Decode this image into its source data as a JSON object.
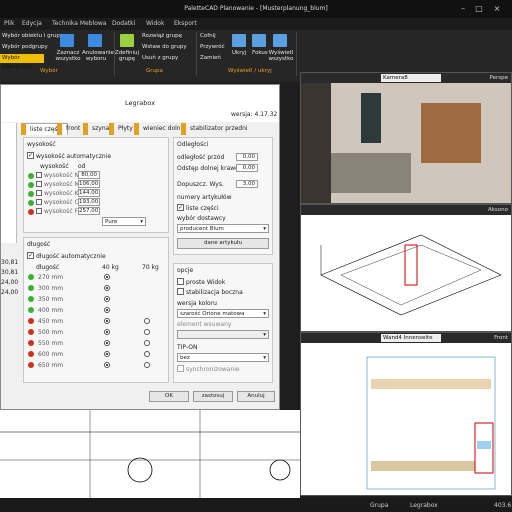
{
  "titlebar": {
    "title": "PaletteCAD Planowanie - [Musterplanung_blum]"
  },
  "menu": [
    "Plik",
    "Edycja",
    "Technika Meblowa",
    "Dodatki",
    "Widok",
    "Eksport"
  ],
  "ribbon": {
    "select_items": [
      "Wybór obiektu i grupy",
      "Wybór podgrupy",
      "Wybór pojedynczy"
    ],
    "select_group": "Wybór",
    "mark_all": "Zaznacz wszystko",
    "cancel_select": "Anulowanie wyboru",
    "define_group": "Zdefiniuj grupę",
    "group_items": [
      "Rozwiąż grupę",
      "Wstaw do grupy",
      "Usuń z grupy"
    ],
    "group_label": "Grupa",
    "undo_items": [
      "Cofnij",
      "Przywróć",
      "Zamień"
    ],
    "hide": "Ukryj",
    "focus": "Fokus",
    "show_all": "Wyświetl wszystko",
    "show_hide_label": "Wyświetl / ukryj"
  },
  "dialog": {
    "title": "Legrabox",
    "version": "wersja: 4.17.32",
    "tabs": [
      "liste części",
      "front",
      "szyna",
      "Płyty",
      "wieniec dolny",
      "stabilizator przedni"
    ],
    "height_section": "wysokość",
    "auto_height": "wysokość automatycznie",
    "col_height": "wysokość",
    "col_od": "od",
    "heights": [
      {
        "label": "wysokość N",
        "value": "80,00",
        "led": "g"
      },
      {
        "label": "wysokość M",
        "value": "106,00",
        "led": "g"
      },
      {
        "label": "wysokość K",
        "value": "144,00",
        "led": "g"
      },
      {
        "label": "wysokość C",
        "value": "193,00",
        "led": "g"
      },
      {
        "label": "wysokość F",
        "value": "257,00",
        "led": "r"
      }
    ],
    "color_select": "Pure",
    "length_section": "długość",
    "auto_length": "długość automatycznie",
    "col_length": "długość",
    "col_40": "40 kg",
    "col_70": "70 kg",
    "lengths": [
      {
        "label": "270 mm",
        "led": "g",
        "k40": true,
        "k70": false
      },
      {
        "label": "300 mm",
        "led": "g",
        "k40": true,
        "k70": false
      },
      {
        "label": "350 mm",
        "led": "g",
        "k40": true,
        "k70": false
      },
      {
        "label": "400 mm",
        "led": "g",
        "k40": true,
        "k70": false
      },
      {
        "label": "450 mm",
        "led": "r",
        "k40": true,
        "k70": true
      },
      {
        "label": "500 mm",
        "led": "r",
        "k40": true,
        "k70": true
      },
      {
        "label": "550 mm",
        "led": "r",
        "k40": true,
        "k70": true
      },
      {
        "label": "600 mm",
        "led": "r",
        "k40": true,
        "k70": true
      },
      {
        "label": "650 mm",
        "led": "r",
        "k40": true,
        "k70": true
      }
    ],
    "distance_section": "Odległości",
    "dist_front": "odległość przód",
    "dist_front_val": "0,00",
    "dist_bottom": "Odstęp dolnej krawędzi",
    "dist_bottom_val": "0,00",
    "allowed_height": "Dopuszcz. Wys.",
    "allowed_height_val": "3,00",
    "article_no": "numery artykułów",
    "parts_list": "liste części",
    "supplier_label": "wybór dostawcy",
    "supplier": "producent Blum",
    "article_data": "dane artykułu",
    "options_section": "opcje",
    "straight_view": "proste Widok",
    "side_stab": "stabilizacja boczna",
    "color_version": "wersja koloru",
    "color_value": "szarość Orione matowa",
    "insert_element": "element wsuwany",
    "tipon": "TIP-ON",
    "tipon_value": "bez",
    "sync": "synchronizowanie",
    "ok": "OK",
    "apply": "zastosuj",
    "cancel": "Anuluj",
    "left_values": [
      "30,81",
      "30,81",
      "24,00",
      "24,00"
    ]
  },
  "viewports": {
    "cam1": "Kamera8",
    "cam1_name": "Perspe",
    "cam2_name": "Aksono",
    "cam3": "Wand4 Innenseite",
    "cam3_name": "Front"
  },
  "status": {
    "group": "Grupa",
    "item": "Legrabox",
    "val": "403.6"
  }
}
